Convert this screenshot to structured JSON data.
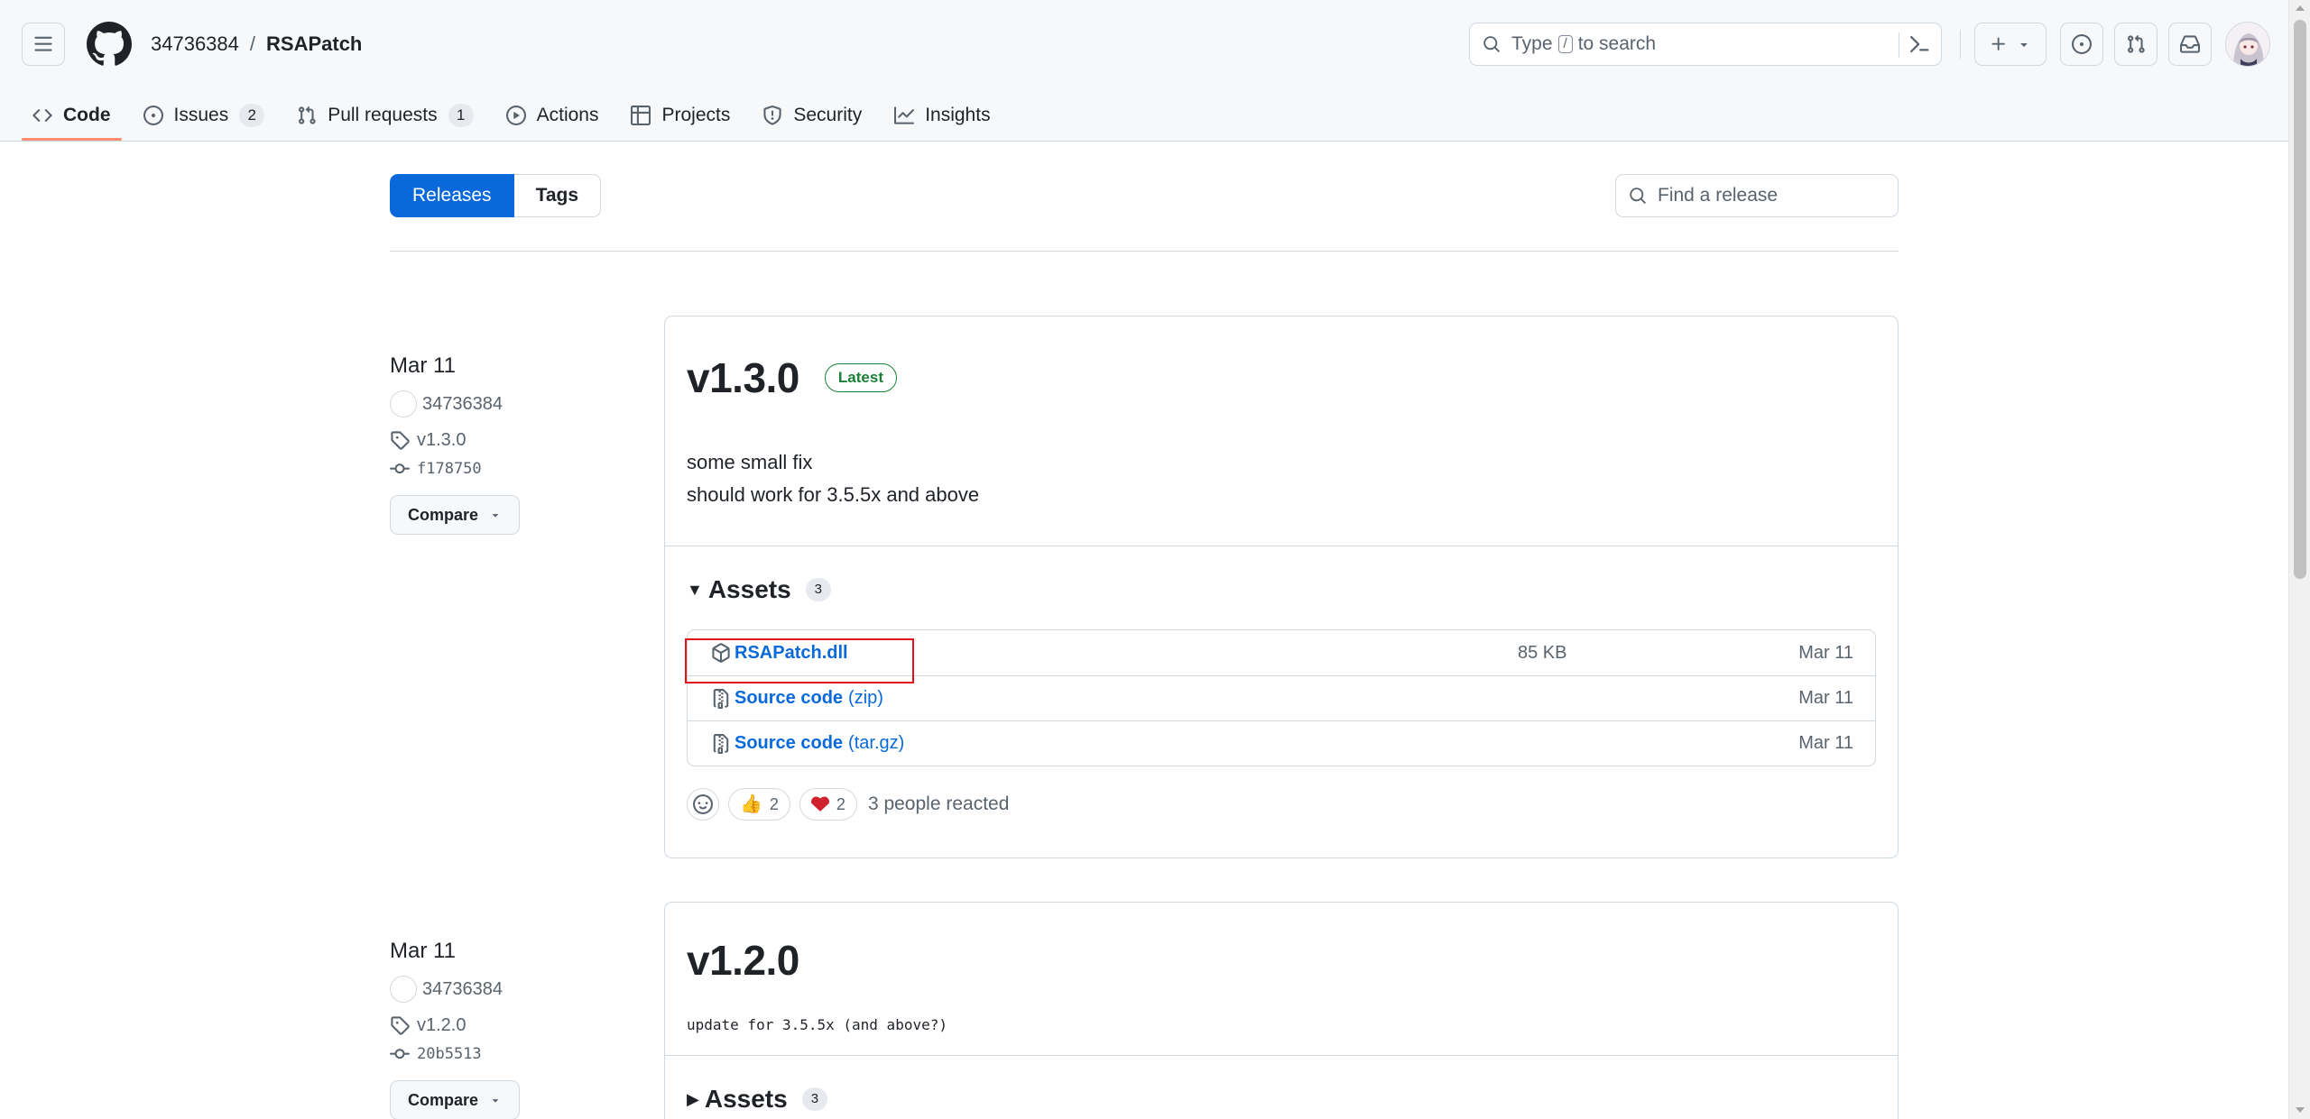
{
  "header": {
    "owner": "34736384",
    "separator": "/",
    "repo": "RSAPatch",
    "search": {
      "prefix": "Type",
      "key": "/",
      "suffix": "to search"
    }
  },
  "repo_nav": [
    {
      "label": "Code",
      "icon": "code-icon",
      "selected": true,
      "count": null
    },
    {
      "label": "Issues",
      "icon": "issue-opened-icon",
      "selected": false,
      "count": "2"
    },
    {
      "label": "Pull requests",
      "icon": "git-pull-request-icon",
      "selected": false,
      "count": "1"
    },
    {
      "label": "Actions",
      "icon": "play-icon",
      "selected": false,
      "count": null
    },
    {
      "label": "Projects",
      "icon": "table-icon",
      "selected": false,
      "count": null
    },
    {
      "label": "Security",
      "icon": "shield-icon",
      "selected": false,
      "count": null
    },
    {
      "label": "Insights",
      "icon": "graph-icon",
      "selected": false,
      "count": null
    }
  ],
  "subnav": {
    "releases": "Releases",
    "tags": "Tags",
    "find_placeholder": "Find a release"
  },
  "releases": [
    {
      "date": "Mar 11",
      "author": "34736384",
      "tag": "v1.3.0",
      "commit": "f178750",
      "compare": "Compare",
      "title": "v1.3.0",
      "badge": "Latest",
      "notes": [
        "some small fix",
        "should work for 3.5.5x and above"
      ],
      "assets_label": "Assets",
      "assets_count": "3",
      "assets": [
        {
          "name": "RSAPatch.dll",
          "suffix": "",
          "size": "85 KB",
          "date": "Mar 11",
          "icon": "package-icon"
        },
        {
          "name": "Source code",
          "suffix": "(zip)",
          "size": "",
          "date": "Mar 11",
          "icon": "file-zip-icon"
        },
        {
          "name": "Source code",
          "suffix": "(tar.gz)",
          "size": "",
          "date": "Mar 11",
          "icon": "file-zip-icon"
        }
      ],
      "reactions": {
        "thumbs_up": "2",
        "heart": "2",
        "summary": "3 people reacted"
      }
    },
    {
      "date": "Mar 11",
      "author": "34736384",
      "tag": "v1.2.0",
      "commit": "20b5513",
      "compare": "Compare",
      "title": "v1.2.0",
      "notes_mono": "update for 3.5.5x (and above?)",
      "assets_label": "Assets",
      "assets_count": "3"
    }
  ],
  "colors": {
    "accent": "#0969da",
    "latest": "#1a7f37",
    "highlight_box": "#e0121e",
    "tab_underline": "#fd8c73"
  }
}
